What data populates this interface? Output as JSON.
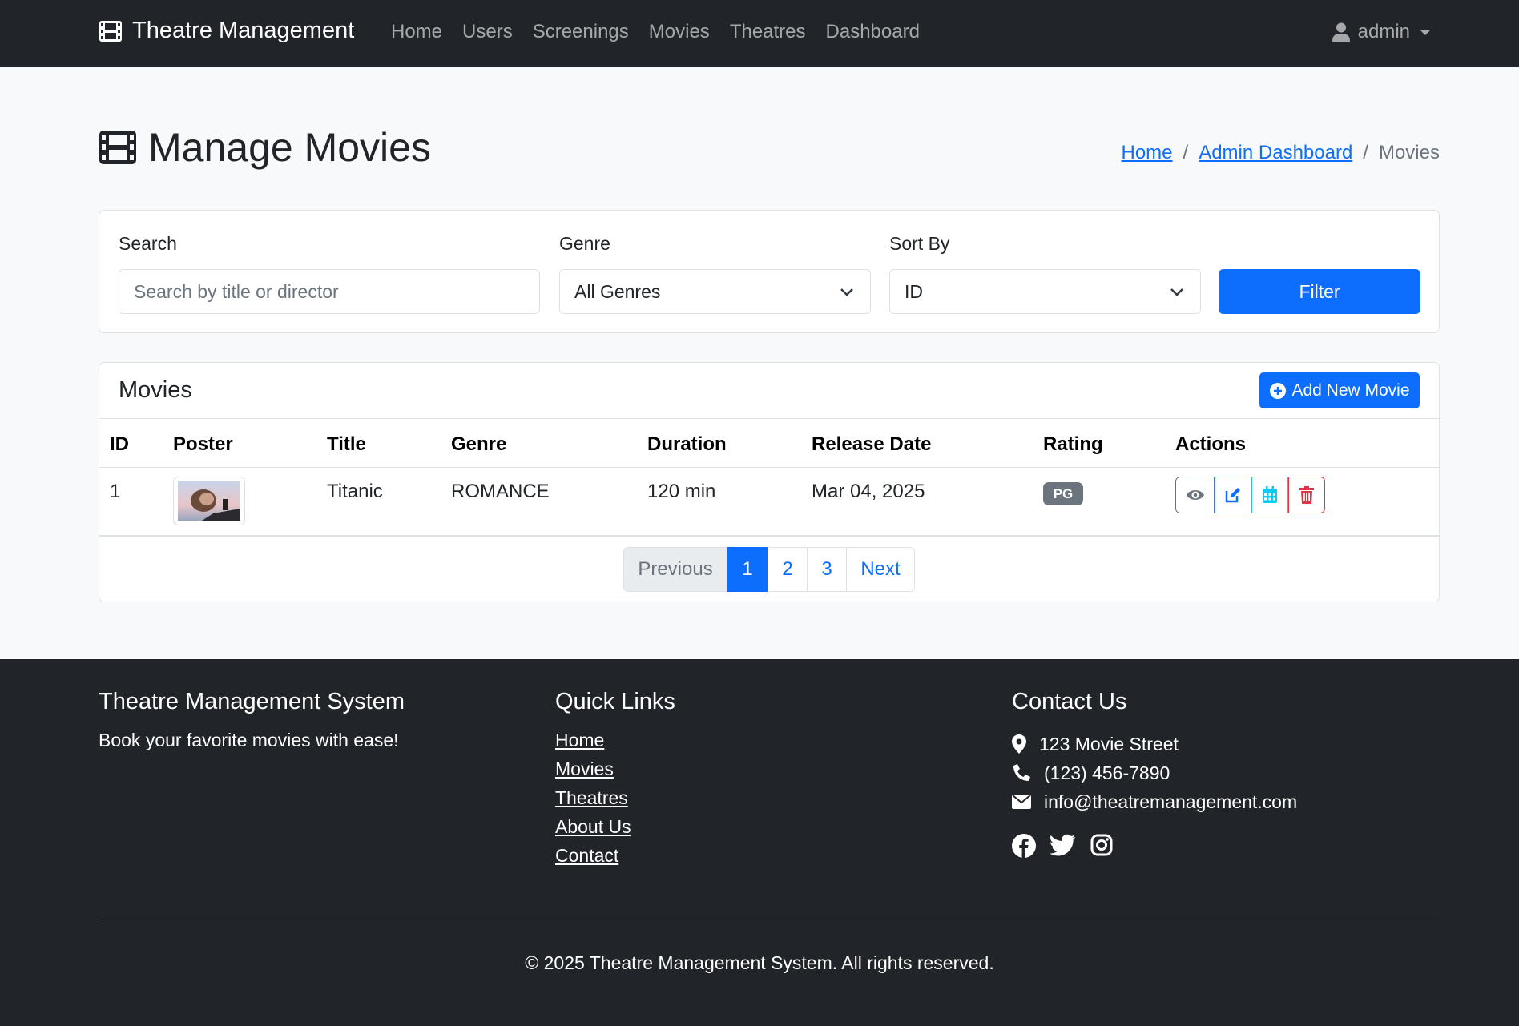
{
  "navbar": {
    "brand": "Theatre Management",
    "links": [
      "Home",
      "Users",
      "Screenings",
      "Movies",
      "Theatres",
      "Dashboard"
    ],
    "user": "admin"
  },
  "page": {
    "title": "Manage Movies",
    "breadcrumb": [
      "Home",
      "Admin Dashboard",
      "Movies"
    ]
  },
  "filters": {
    "search_label": "Search",
    "search_placeholder": "Search by title or director",
    "genre_label": "Genre",
    "genre_value": "All Genres",
    "sort_label": "Sort By",
    "sort_value": "ID",
    "filter_button": "Filter"
  },
  "movies": {
    "card_title": "Movies",
    "add_button": "Add New Movie",
    "columns": [
      "ID",
      "Poster",
      "Title",
      "Genre",
      "Duration",
      "Release Date",
      "Rating",
      "Actions"
    ],
    "rows": [
      {
        "id": "1",
        "title": "Titanic",
        "genre": "ROMANCE",
        "duration": "120 min",
        "release_date": "Mar 04, 2025",
        "rating": "PG"
      }
    ],
    "action_icons": [
      "eye-icon",
      "edit-icon",
      "calendar-icon",
      "trash-icon"
    ]
  },
  "pagination": {
    "previous": "Previous",
    "pages": [
      "1",
      "2",
      "3"
    ],
    "active_page": "1",
    "next": "Next"
  },
  "footer": {
    "col1_title": "Theatre Management System",
    "col1_text": "Book your favorite movies with ease!",
    "col2_title": "Quick Links",
    "links": [
      "Home",
      "Movies",
      "Theatres",
      "About Us",
      "Contact"
    ],
    "col3_title": "Contact Us",
    "address": "123 Movie Street",
    "phone": "(123) 456-7890",
    "email": "info@theatremanagement.com",
    "socials": [
      "facebook-icon",
      "twitter-icon",
      "instagram-icon"
    ],
    "copyright": "© 2025 Theatre Management System. All rights reserved."
  },
  "colors": {
    "primary": "#0d6efd",
    "dark": "#212529",
    "info": "#0dcaf0",
    "danger": "#dc3545",
    "secondary": "#6c757d"
  }
}
